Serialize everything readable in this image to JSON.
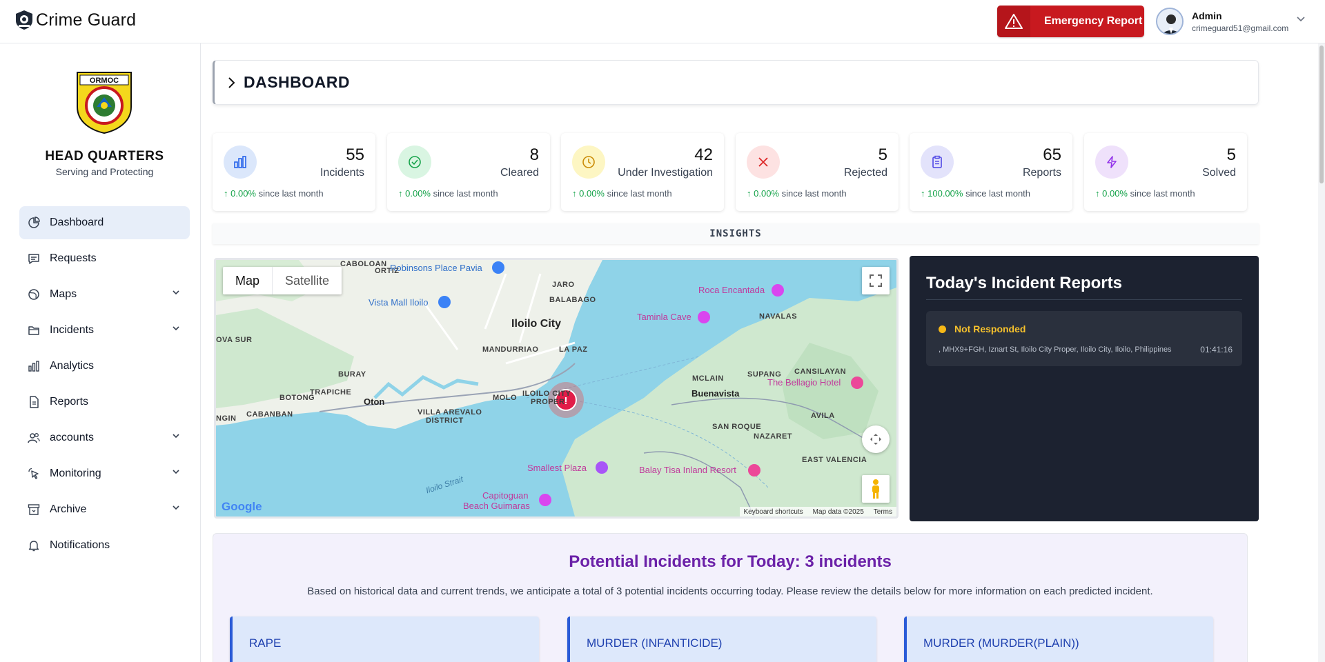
{
  "app": {
    "title": "Crime Guard"
  },
  "header": {
    "emergency_label": "Emergency Report",
    "user_name": "Admin",
    "user_email": "crimeguard51@gmail.com"
  },
  "sidebar": {
    "logo_text": "ORMOC",
    "title": "HEAD QUARTERS",
    "subtitle": "Serving and Protecting",
    "items": [
      {
        "label": "Dashboard",
        "icon": "pie-chart-icon",
        "active": true
      },
      {
        "label": "Requests",
        "icon": "message-icon"
      },
      {
        "label": "Maps",
        "icon": "globe-icon",
        "expandable": true
      },
      {
        "label": "Incidents",
        "icon": "folder-icon",
        "expandable": true
      },
      {
        "label": "Analytics",
        "icon": "bar-chart-icon"
      },
      {
        "label": "Reports",
        "icon": "file-icon"
      },
      {
        "label": "accounts",
        "icon": "users-icon",
        "expandable": true
      },
      {
        "label": "Monitoring",
        "icon": "pointer-icon",
        "expandable": true
      },
      {
        "label": "Archive",
        "icon": "archive-icon",
        "expandable": true
      },
      {
        "label": "Notifications",
        "icon": "bell-icon"
      }
    ]
  },
  "page": {
    "title": "DASHBOARD",
    "insights_label": "INSIGHTS"
  },
  "stats": [
    {
      "value": "55",
      "label": "Incidents",
      "change": "0.00%",
      "since": "since last month",
      "icon": "bar-chart-icon",
      "color": "#2563eb",
      "bg": "#dbe7fb"
    },
    {
      "value": "8",
      "label": "Cleared",
      "change": "0.00%",
      "since": "since last month",
      "icon": "check-circle-icon",
      "color": "#16a34a",
      "bg": "#d9f5e2"
    },
    {
      "value": "42",
      "label": "Under Investigation",
      "change": "0.00%",
      "since": "since last month",
      "icon": "clock-icon",
      "color": "#ca8a04",
      "bg": "#fdf6c3"
    },
    {
      "value": "5",
      "label": "Rejected",
      "change": "0.00%",
      "since": "since last month",
      "icon": "x-icon",
      "color": "#dc2626",
      "bg": "#fde2e2"
    },
    {
      "value": "65",
      "label": "Reports",
      "change": "100.00%",
      "since": "since last month",
      "icon": "clipboard-icon",
      "color": "#4f46e5",
      "bg": "#e3e3fb"
    },
    {
      "value": "5",
      "label": "Solved",
      "change": "0.00%",
      "since": "since last month",
      "icon": "bolt-icon",
      "color": "#9333ea",
      "bg": "#efe1fb"
    }
  ],
  "map": {
    "tab_map": "Map",
    "tab_satellite": "Satellite",
    "labels": {
      "iloilo_city": "Iloilo City",
      "mandurriao": "MANDURRIAO",
      "la_paz": "LA PAZ",
      "jaro": "JARO",
      "balabago": "BALABAGO",
      "caboloan": "CABOLOAN",
      "ortiz": "ORTIZ",
      "ova_sur": "OVA SUR",
      "buray": "BURAY",
      "trapiche": "TRAPICHE",
      "botong": "BOTONG",
      "oton": "Oton",
      "cabanban": "CABANBAN",
      "ngin": "NGIN",
      "molo": "MOLO",
      "villa_arevalo": "VILLA AREVALO",
      "district": "DISTRICT",
      "iloilo_city_proper": "ILOILO CITY",
      "proper": "PROPER",
      "buenavista": "Buenavista",
      "mclain": "MCLAIN",
      "supang": "SUPANG",
      "cansilayan": "CANSILAYAN",
      "navalas": "NAVALAS",
      "san_roque": "SAN ROQUE",
      "nazaret": "NAZARET",
      "avila": "AVILA",
      "east_valencia": "EAST VALENCIA",
      "robinsons": "Robinsons Place Pavia",
      "vista_mall": "Vista Mall Iloilo",
      "roca": "Roca Encantada",
      "taminla": "Taminla Cave",
      "bellagio": "The Bellagio Hotel",
      "smallest_plaza": "Smallest Plaza",
      "balay_tisa": "Balay Tisa Inland Resort",
      "capitoguan": "Capitoguan",
      "beach_guimaras": "Beach Guimaras",
      "iloilo_strait": "Iloilo Strait"
    },
    "google": "Google",
    "footer": {
      "shortcuts": "Keyboard shortcuts",
      "data": "Map data ©2025",
      "terms": "Terms"
    }
  },
  "reports": {
    "title": "Today's Incident Reports",
    "items": [
      {
        "status": "Not Responded",
        "address": ", MHX9+FGH, Iznart St, Iloilo City Proper, Iloilo City, Iloilo, Philippines",
        "time": "01:41:16"
      }
    ]
  },
  "potential": {
    "title": "Potential Incidents for Today: 3 incidents",
    "description": "Based on historical data and current trends, we anticipate a total of 3 potential incidents occurring today. Please review the details below for more information on each predicted incident.",
    "cards": [
      {
        "label": "RAPE"
      },
      {
        "label": "MURDER (INFANTICIDE)"
      },
      {
        "label": "MURDER (MURDER(PLAIN))"
      }
    ]
  }
}
